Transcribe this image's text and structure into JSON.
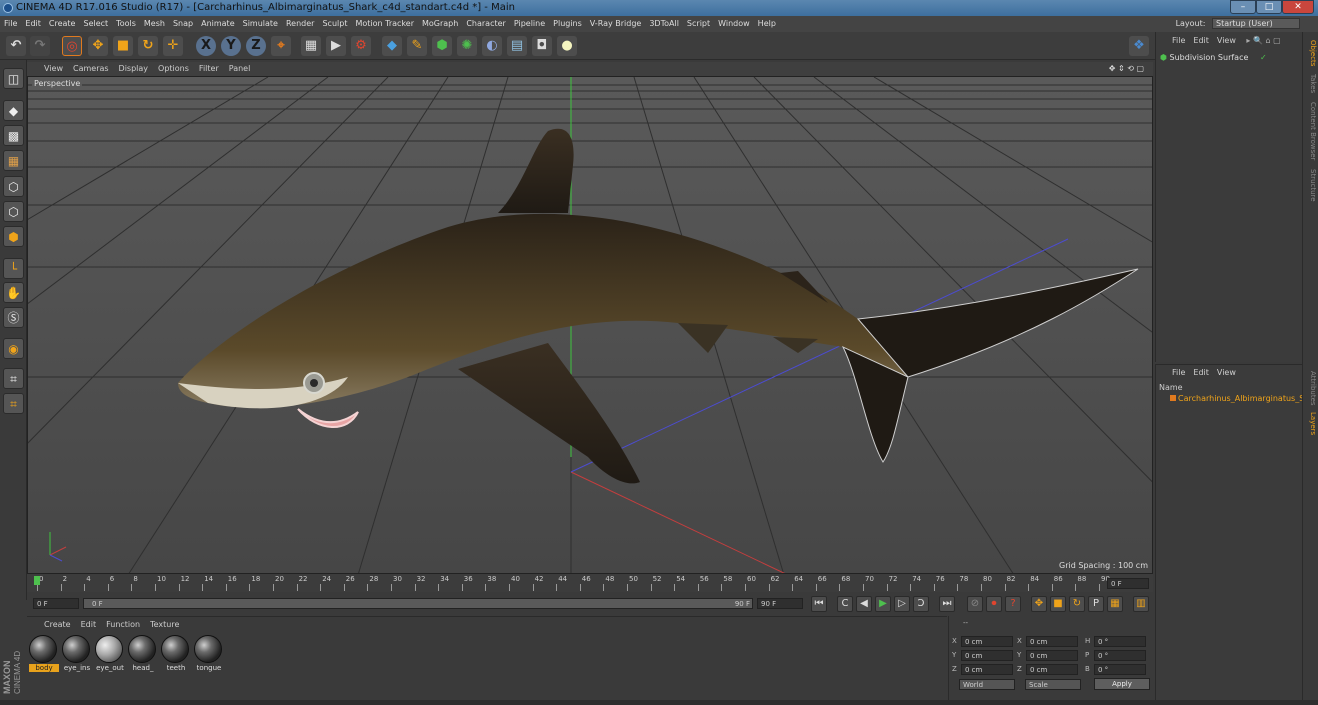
{
  "window": {
    "title": "CINEMA 4D R17.016 Studio (R17) - [Carcharhinus_Albimarginatus_Shark_c4d_standart.c4d *] - Main",
    "controls": [
      "minimize-icon",
      "maximize-icon",
      "close-icon"
    ]
  },
  "menu": [
    "File",
    "Edit",
    "Create",
    "Select",
    "Tools",
    "Mesh",
    "Snap",
    "Animate",
    "Simulate",
    "Render",
    "Sculpt",
    "Motion Tracker",
    "MoGraph",
    "Character",
    "Pipeline",
    "Plugins",
    "V-Ray Bridge",
    "3DToAll",
    "Script",
    "Window",
    "Help"
  ],
  "layout": {
    "label": "Layout:",
    "value": "Startup (User)"
  },
  "toolbar": {
    "axis_x": "X",
    "axis_y": "Y",
    "axis_z": "Z"
  },
  "viewport": {
    "menu": [
      "View",
      "Cameras",
      "Display",
      "Options",
      "Filter",
      "Panel"
    ],
    "label": "Perspective",
    "grid_spacing": "Grid Spacing : 100 cm"
  },
  "timeline": {
    "ticks": [
      "0",
      "2",
      "4",
      "6",
      "8",
      "10",
      "12",
      "14",
      "16",
      "18",
      "20",
      "22",
      "24",
      "26",
      "28",
      "30",
      "32",
      "34",
      "36",
      "38",
      "40",
      "42",
      "44",
      "46",
      "48",
      "50",
      "52",
      "54",
      "56",
      "58",
      "60",
      "62",
      "64",
      "66",
      "68",
      "70",
      "72",
      "74",
      "76",
      "78",
      "80",
      "82",
      "84",
      "86",
      "88",
      "90"
    ],
    "current_frame": "0 F"
  },
  "transport": {
    "start": "0 F",
    "scrub": "0 F",
    "scrub_end": "90 F",
    "end": "90 F"
  },
  "materials": {
    "menu": [
      "Create",
      "Edit",
      "Function",
      "Texture"
    ],
    "items": [
      {
        "label": "body",
        "active": true
      },
      {
        "label": "eye_ins",
        "active": false
      },
      {
        "label": "eye_out",
        "active": false
      },
      {
        "label": "head_",
        "active": false
      },
      {
        "label": "teeth",
        "active": false
      },
      {
        "label": "tongue",
        "active": false
      }
    ]
  },
  "coordinates": {
    "header": "--",
    "rows": [
      {
        "a": "X",
        "av": "0 cm",
        "b": "X",
        "bv": "0 cm",
        "c": "H",
        "cv": "0 °"
      },
      {
        "a": "Y",
        "av": "0 cm",
        "b": "Y",
        "bv": "0 cm",
        "c": "P",
        "cv": "0 °"
      },
      {
        "a": "Z",
        "av": "0 cm",
        "b": "Z",
        "bv": "0 cm",
        "c": "B",
        "cv": "0 °"
      }
    ],
    "world": "World",
    "scale": "Scale",
    "apply": "Apply"
  },
  "objects": {
    "menu": [
      "File",
      "Edit",
      "View"
    ],
    "item": "Subdivision Surface"
  },
  "layers": {
    "menu": [
      "File",
      "Edit",
      "View"
    ],
    "column": "Name",
    "item": "Carcharhinus_Albimarginatus_Sha"
  },
  "right_tabs": [
    "Objects",
    "Takes",
    "Content Browser",
    "Structure",
    "Attributes",
    "Layers"
  ],
  "logo": {
    "line1": "MAXON",
    "line2": "CINEMA 4D"
  }
}
